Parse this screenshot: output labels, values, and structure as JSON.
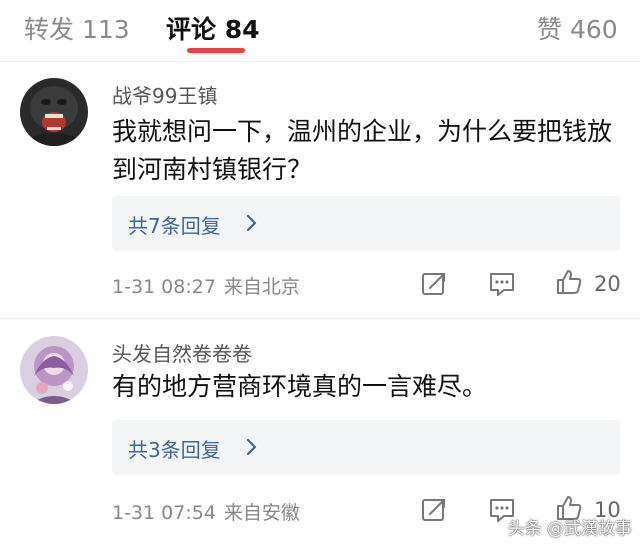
{
  "tabs": [
    {
      "label": "转发 113"
    },
    {
      "label": "评论 84"
    },
    {
      "label": "赞 460"
    }
  ],
  "active_tab": 1,
  "accent_color": "#f04142",
  "link_color": "#406599",
  "comments": [
    {
      "username": "战爷99王镇",
      "content": "我就想问一下，温州的企业，为什么要把钱放到河南村镇银行？",
      "replies_label": "共7条回复",
      "time": "1-31 08:27",
      "source": "来自北京",
      "likes": "20"
    },
    {
      "username": "头发自然卷卷卷",
      "content": "有的地方营商环境真的一言难尽。",
      "replies_label": "共3条回复",
      "time": "1-31 07:54",
      "source": "来自安徽",
      "likes": "10"
    }
  ],
  "watermark": "头条 @武漢故事"
}
